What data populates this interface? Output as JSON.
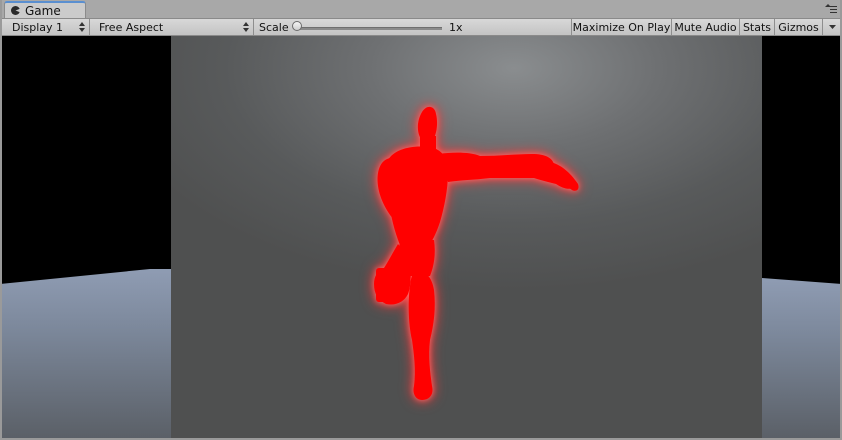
{
  "tab": {
    "title": "Game",
    "icon": "pacman-icon"
  },
  "panel_menu_icon": "panel-menu-icon",
  "toolbar": {
    "display": "Display 1",
    "aspect": "Free Aspect",
    "scale_label": "Scale",
    "scale_value": "1x",
    "scale_level": 0,
    "maximize": "Maximize On Play",
    "mute": "Mute Audio",
    "stats": "Stats",
    "gizmos": "Gizmos"
  },
  "scene": {
    "figure_color": "#ff0000",
    "glow_color": "#ff4d4d",
    "background_color": "#000000"
  }
}
